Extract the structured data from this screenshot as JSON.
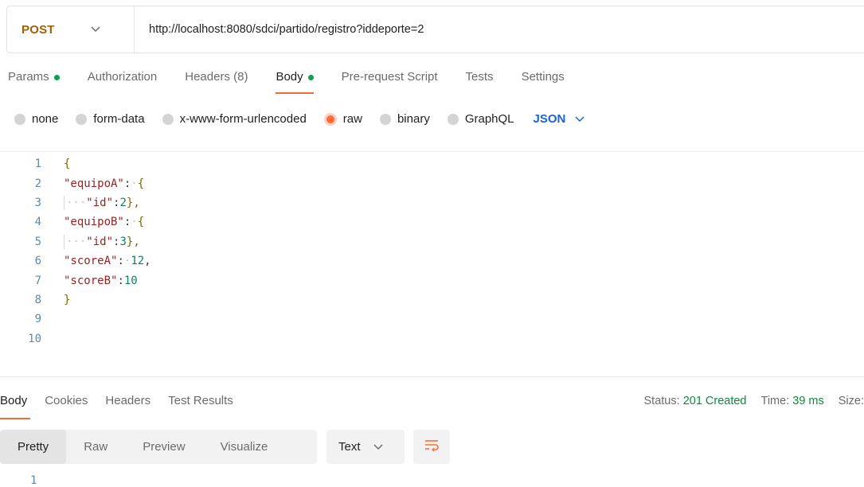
{
  "request": {
    "method": "POST",
    "url": "http://localhost:8080/sdci/partido/registro?iddeporte=2"
  },
  "request_tabs": [
    {
      "label": "Params",
      "dot": true
    },
    {
      "label": "Authorization",
      "dot": false
    },
    {
      "label": "Headers (8)",
      "dot": false
    },
    {
      "label": "Body",
      "dot": true,
      "active": true
    },
    {
      "label": "Pre-request Script",
      "dot": false
    },
    {
      "label": "Tests",
      "dot": false
    },
    {
      "label": "Settings",
      "dot": false
    }
  ],
  "body_types": {
    "options": [
      "none",
      "form-data",
      "x-www-form-urlencoded",
      "raw",
      "binary",
      "GraphQL"
    ],
    "selected": "raw",
    "format": "JSON"
  },
  "editor": {
    "line_numbers": [
      "1",
      "2",
      "3",
      "4",
      "5",
      "6",
      "7",
      "8",
      "9",
      "10"
    ],
    "lines": {
      "l1_open": "{",
      "l2_key": "\"equipoA\"",
      "l2_rest": ":",
      "l2_open": "{",
      "l3_key": "\"id\"",
      "l3_colon": ":",
      "l3_val": "2",
      "l3_close": "},",
      "l4_key": "\"equipoB\"",
      "l4_rest": ":",
      "l4_open": "{",
      "l5_key": "\"id\"",
      "l5_colon": ":",
      "l5_val": "3",
      "l5_close": "},",
      "l6_key": "\"scoreA\"",
      "l6_colon": ":",
      "l6_val": "12",
      "l6_comma": ",",
      "l7_key": "\"scoreB\"",
      "l7_colon": ":",
      "l7_val": "10",
      "l8_close": "}"
    }
  },
  "response": {
    "tabs": [
      "Body",
      "Cookies",
      "Headers",
      "Test Results"
    ],
    "active_tab": "Body",
    "status_label": "Status:",
    "status_value": "201 Created",
    "time_label": "Time:",
    "time_value": "39 ms",
    "size_label": "Size:",
    "view_modes": [
      "Pretty",
      "Raw",
      "Preview",
      "Visualize"
    ],
    "active_view": "Pretty",
    "text_format": "Text",
    "first_line": "1"
  },
  "colors": {
    "accent": "#ff6c37",
    "method": "#a65e00",
    "success": "#0c8a3c",
    "json_select": "#1a63d6"
  },
  "icons": {
    "method_dropdown": "chevron-down-icon",
    "json_dropdown": "chevron-down-icon",
    "text_dropdown": "chevron-down-icon",
    "wrap": "wrap-lines-icon"
  }
}
